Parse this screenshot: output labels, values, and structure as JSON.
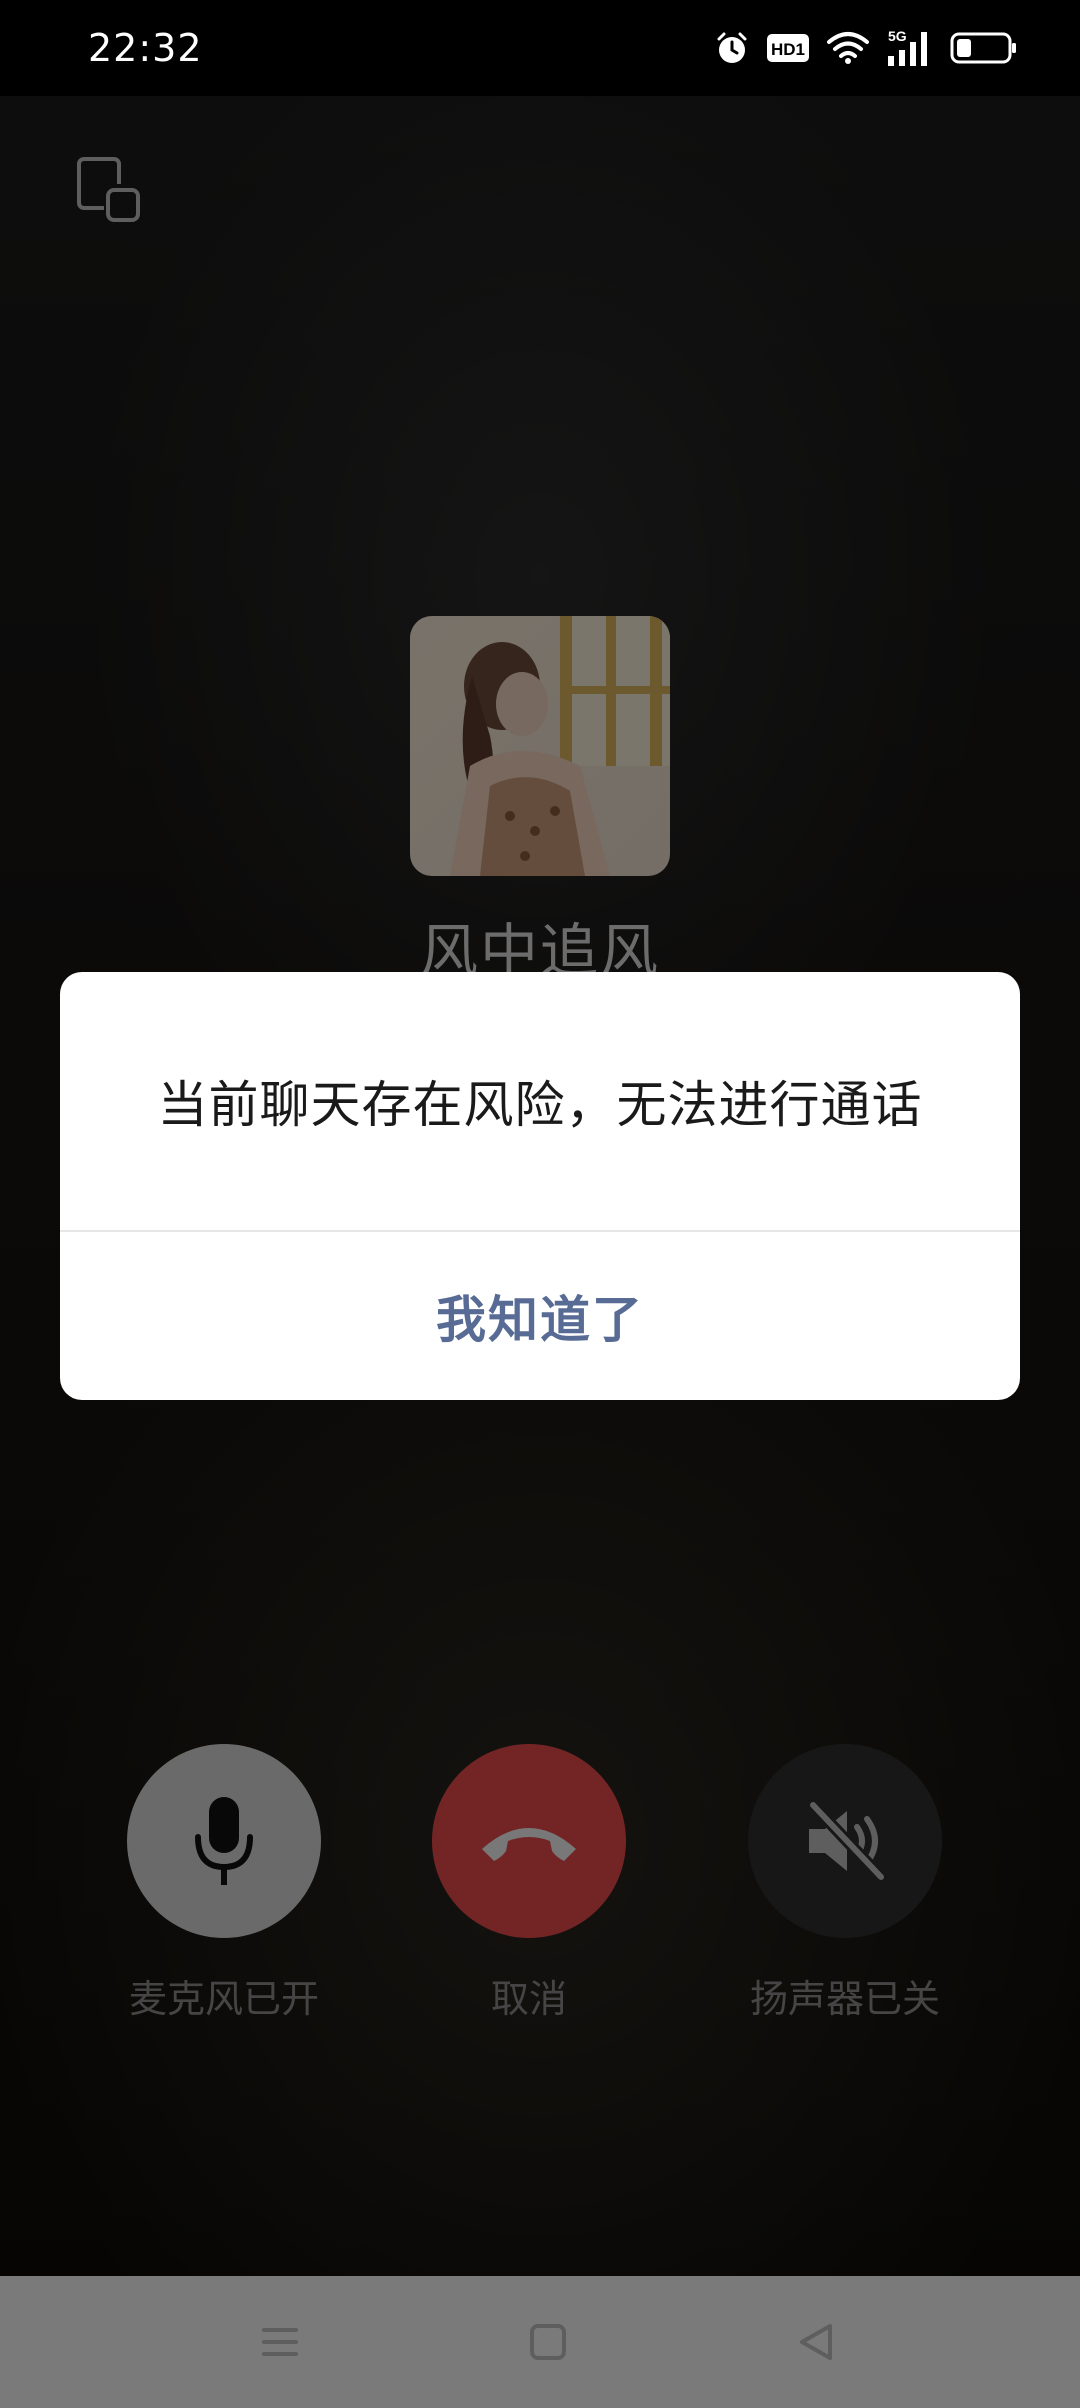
{
  "status_bar": {
    "time": "22:32",
    "icons": [
      "alarm-icon",
      "hd-icon",
      "wifi-icon",
      "5g-signal-icon",
      "battery-icon"
    ],
    "hd_text": "HD1",
    "network_text": "5G"
  },
  "call": {
    "contact_name": "风中追风",
    "controls": {
      "mic_label": "麦克风已开",
      "hangup_label": "取消",
      "speaker_label": "扬声器已关"
    },
    "colors": {
      "hangup": "#e64a4a",
      "mic": "#d5d5d5",
      "speaker": "#2e2e2e"
    }
  },
  "dialog": {
    "message": "当前聊天存在风险，无法进行通话",
    "confirm_label": "我知道了",
    "confirm_color": "#576b95"
  }
}
